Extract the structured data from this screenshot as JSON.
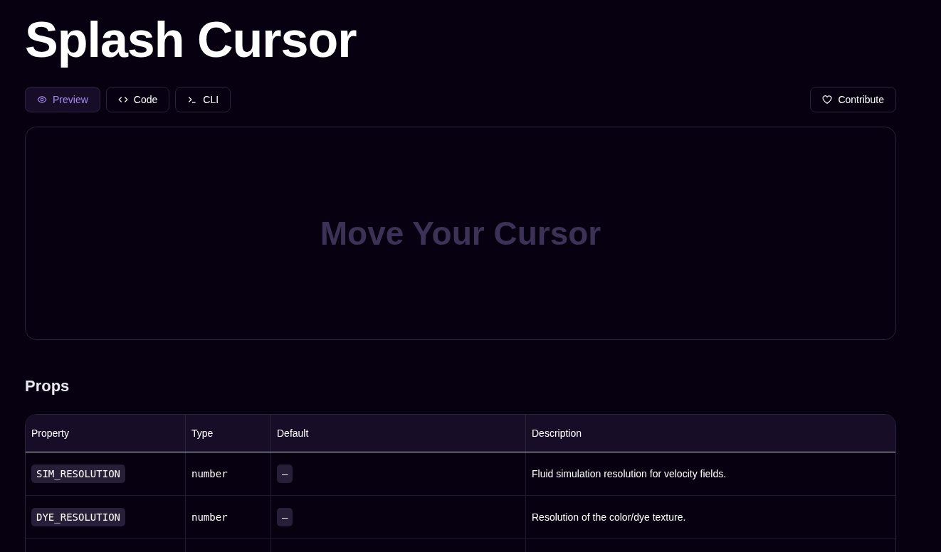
{
  "title": "Splash Cursor",
  "tabs": [
    {
      "label": "Preview",
      "selected": true
    },
    {
      "label": "Code",
      "selected": false
    },
    {
      "label": "CLI",
      "selected": false
    }
  ],
  "contribute_button": {
    "label": "Contribute"
  },
  "preview": {
    "caption": "Move Your Cursor"
  },
  "props": {
    "heading": "Props",
    "table": {
      "columns": [
        "Property",
        "Type",
        "Default",
        "Description"
      ],
      "rows": [
        {
          "property": "SIM_RESOLUTION",
          "type": "number",
          "default": "—",
          "description": "Fluid simulation resolution for velocity fields."
        },
        {
          "property": "DYE_RESOLUTION",
          "type": "number",
          "default": "—",
          "description": "Resolution of the color/dye texture."
        }
      ]
    }
  }
}
